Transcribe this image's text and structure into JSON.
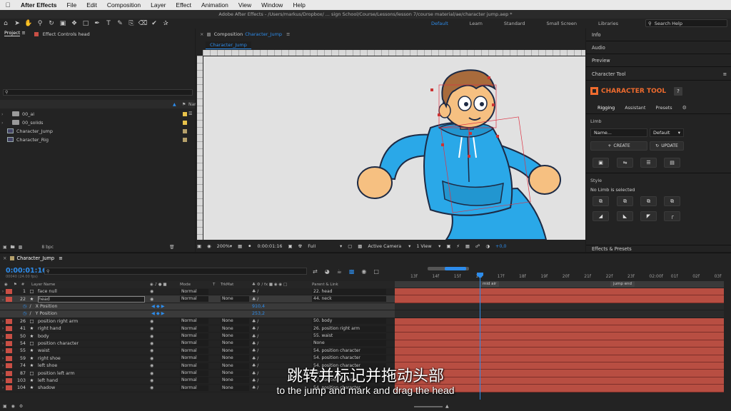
{
  "menubar": {
    "app": "After Effects",
    "items": [
      "File",
      "Edit",
      "Composition",
      "Layer",
      "Effect",
      "Animation",
      "View",
      "Window",
      "Help"
    ]
  },
  "titlebar": {
    "text": "Adobe After Effects - /Users/markus/Dropbox/ ... sign School/Course/Lessons/lesson 7/course material/ae/character jump.aep *"
  },
  "workspaces": [
    "Default",
    "Learn",
    "Standard",
    "Small Screen",
    "Libraries"
  ],
  "search_help": {
    "placeholder": "Search Help"
  },
  "project": {
    "tab_project": "Project",
    "tab_effects": "Effect Controls head",
    "name_header": "Name",
    "items": [
      {
        "name": "00_ai",
        "type": "folder",
        "color": "#e8c24a"
      },
      {
        "name": "00_solids",
        "type": "folder",
        "color": "#e8c24a"
      },
      {
        "name": "Character_Jump",
        "type": "comp",
        "color": "#b5a06a"
      },
      {
        "name": "Character_Rig",
        "type": "comp",
        "color": "#b5a06a"
      }
    ],
    "bpc": "8 bpc"
  },
  "composition": {
    "tab_label": "Composition",
    "tab_comp": "Character_Jump",
    "subtab": "Character_Jump",
    "zoom": "200%",
    "timecode": "0:00:01:16",
    "resolution": "Full",
    "camera": "Active Camera",
    "views": "1 View",
    "exposure": "+0,0"
  },
  "right_panels": {
    "info": "Info",
    "audio": "Audio",
    "preview": "Preview",
    "character_tool": "Character Tool",
    "effects_presets": "Effects & Presets"
  },
  "character_tool": {
    "title": "CHARACTER TOOL",
    "help": "?",
    "tabs": [
      "Rigging",
      "Assistant",
      "Presets"
    ],
    "limb_label": "Limb",
    "name_placeholder": "Name...",
    "default_option": "Default",
    "create_label": "CREATE",
    "update_label": "UPDATE",
    "style_label": "Style",
    "no_limb": "No Limb is selected"
  },
  "timeline": {
    "tab": "Character_Jump",
    "time": "0:00:01:16",
    "fps": "00040 (24.00 fps)",
    "headers": {
      "layer_name": "Layer Name",
      "mode": "Mode",
      "t": "T",
      "trkmat": "TrkMat",
      "parent": "Parent & Link"
    },
    "ruler_labels": [
      "13f",
      "14f",
      "15f",
      "16f",
      "17f",
      "18f",
      "19f",
      "20f",
      "21f",
      "22f",
      "23f",
      "02:00f",
      "01f",
      "02f",
      "03f"
    ],
    "markers": {
      "mid": "mid air",
      "end": "jump end"
    },
    "layers": [
      {
        "num": "1",
        "name": "face null",
        "type": "box",
        "color": "#c94f45",
        "mode": "Normal",
        "trkmat": "",
        "parent": "22. head",
        "sel": false
      },
      {
        "num": "22",
        "name": "head",
        "type": "star",
        "color": "#c94f45",
        "mode": "Normal",
        "trkmat": "None",
        "parent": "44. neck",
        "sel": true
      },
      {
        "num": "",
        "name": "X Position",
        "type": "prop",
        "color": "",
        "mode": "",
        "trkmat": "",
        "parent": "",
        "value": "910,4",
        "sel": true
      },
      {
        "num": "",
        "name": "Y Position",
        "type": "prop",
        "color": "",
        "mode": "",
        "trkmat": "",
        "parent": "",
        "value": "253,2",
        "sel": true
      },
      {
        "num": "26",
        "name": "position right arm",
        "type": "box",
        "color": "#c94f45",
        "mode": "Normal",
        "trkmat": "None",
        "parent": "50. body",
        "sel": false
      },
      {
        "num": "41",
        "name": "right hand",
        "type": "star",
        "color": "#c94f45",
        "mode": "Normal",
        "trkmat": "None",
        "parent": "26. position right arm",
        "sel": false
      },
      {
        "num": "50",
        "name": "body",
        "type": "star",
        "color": "#c94f45",
        "mode": "Normal",
        "trkmat": "None",
        "parent": "55. waist",
        "sel": false
      },
      {
        "num": "54",
        "name": "position character",
        "type": "box",
        "color": "#c94f45",
        "mode": "Normal",
        "trkmat": "None",
        "parent": "None",
        "sel": false
      },
      {
        "num": "55",
        "name": "waist",
        "type": "star",
        "color": "#c94f45",
        "mode": "Normal",
        "trkmat": "None",
        "parent": "54. position character",
        "sel": false
      },
      {
        "num": "59",
        "name": "right shoe",
        "type": "star",
        "color": "#c94f45",
        "mode": "Normal",
        "trkmat": "None",
        "parent": "54. position character",
        "sel": false
      },
      {
        "num": "74",
        "name": "left shoe",
        "type": "star",
        "color": "#c94f45",
        "mode": "Normal",
        "trkmat": "None",
        "parent": "54. position character",
        "sel": false
      },
      {
        "num": "87",
        "name": "position left arm",
        "type": "box",
        "color": "#c94f45",
        "mode": "Normal",
        "trkmat": "None",
        "parent": "50. body",
        "sel": false
      },
      {
        "num": "103",
        "name": "left hand",
        "type": "star",
        "color": "#c94f45",
        "mode": "Normal",
        "trkmat": "None",
        "parent": "87. position left arm",
        "sel": false
      },
      {
        "num": "104",
        "name": "shadow",
        "type": "star",
        "color": "#c94f45",
        "mode": "Normal",
        "trkmat": "None",
        "parent": "54. position character",
        "sel": false
      }
    ]
  },
  "subtitles": {
    "zh": "跳转并标记并拖动头部",
    "en": "to the jump and mark and drag the head"
  },
  "colors": {
    "accent": "#2d8ceb",
    "tool_orange": "#ef6b2e",
    "layer_red": "#b84e42",
    "character_blue": "#2aa8e8"
  }
}
